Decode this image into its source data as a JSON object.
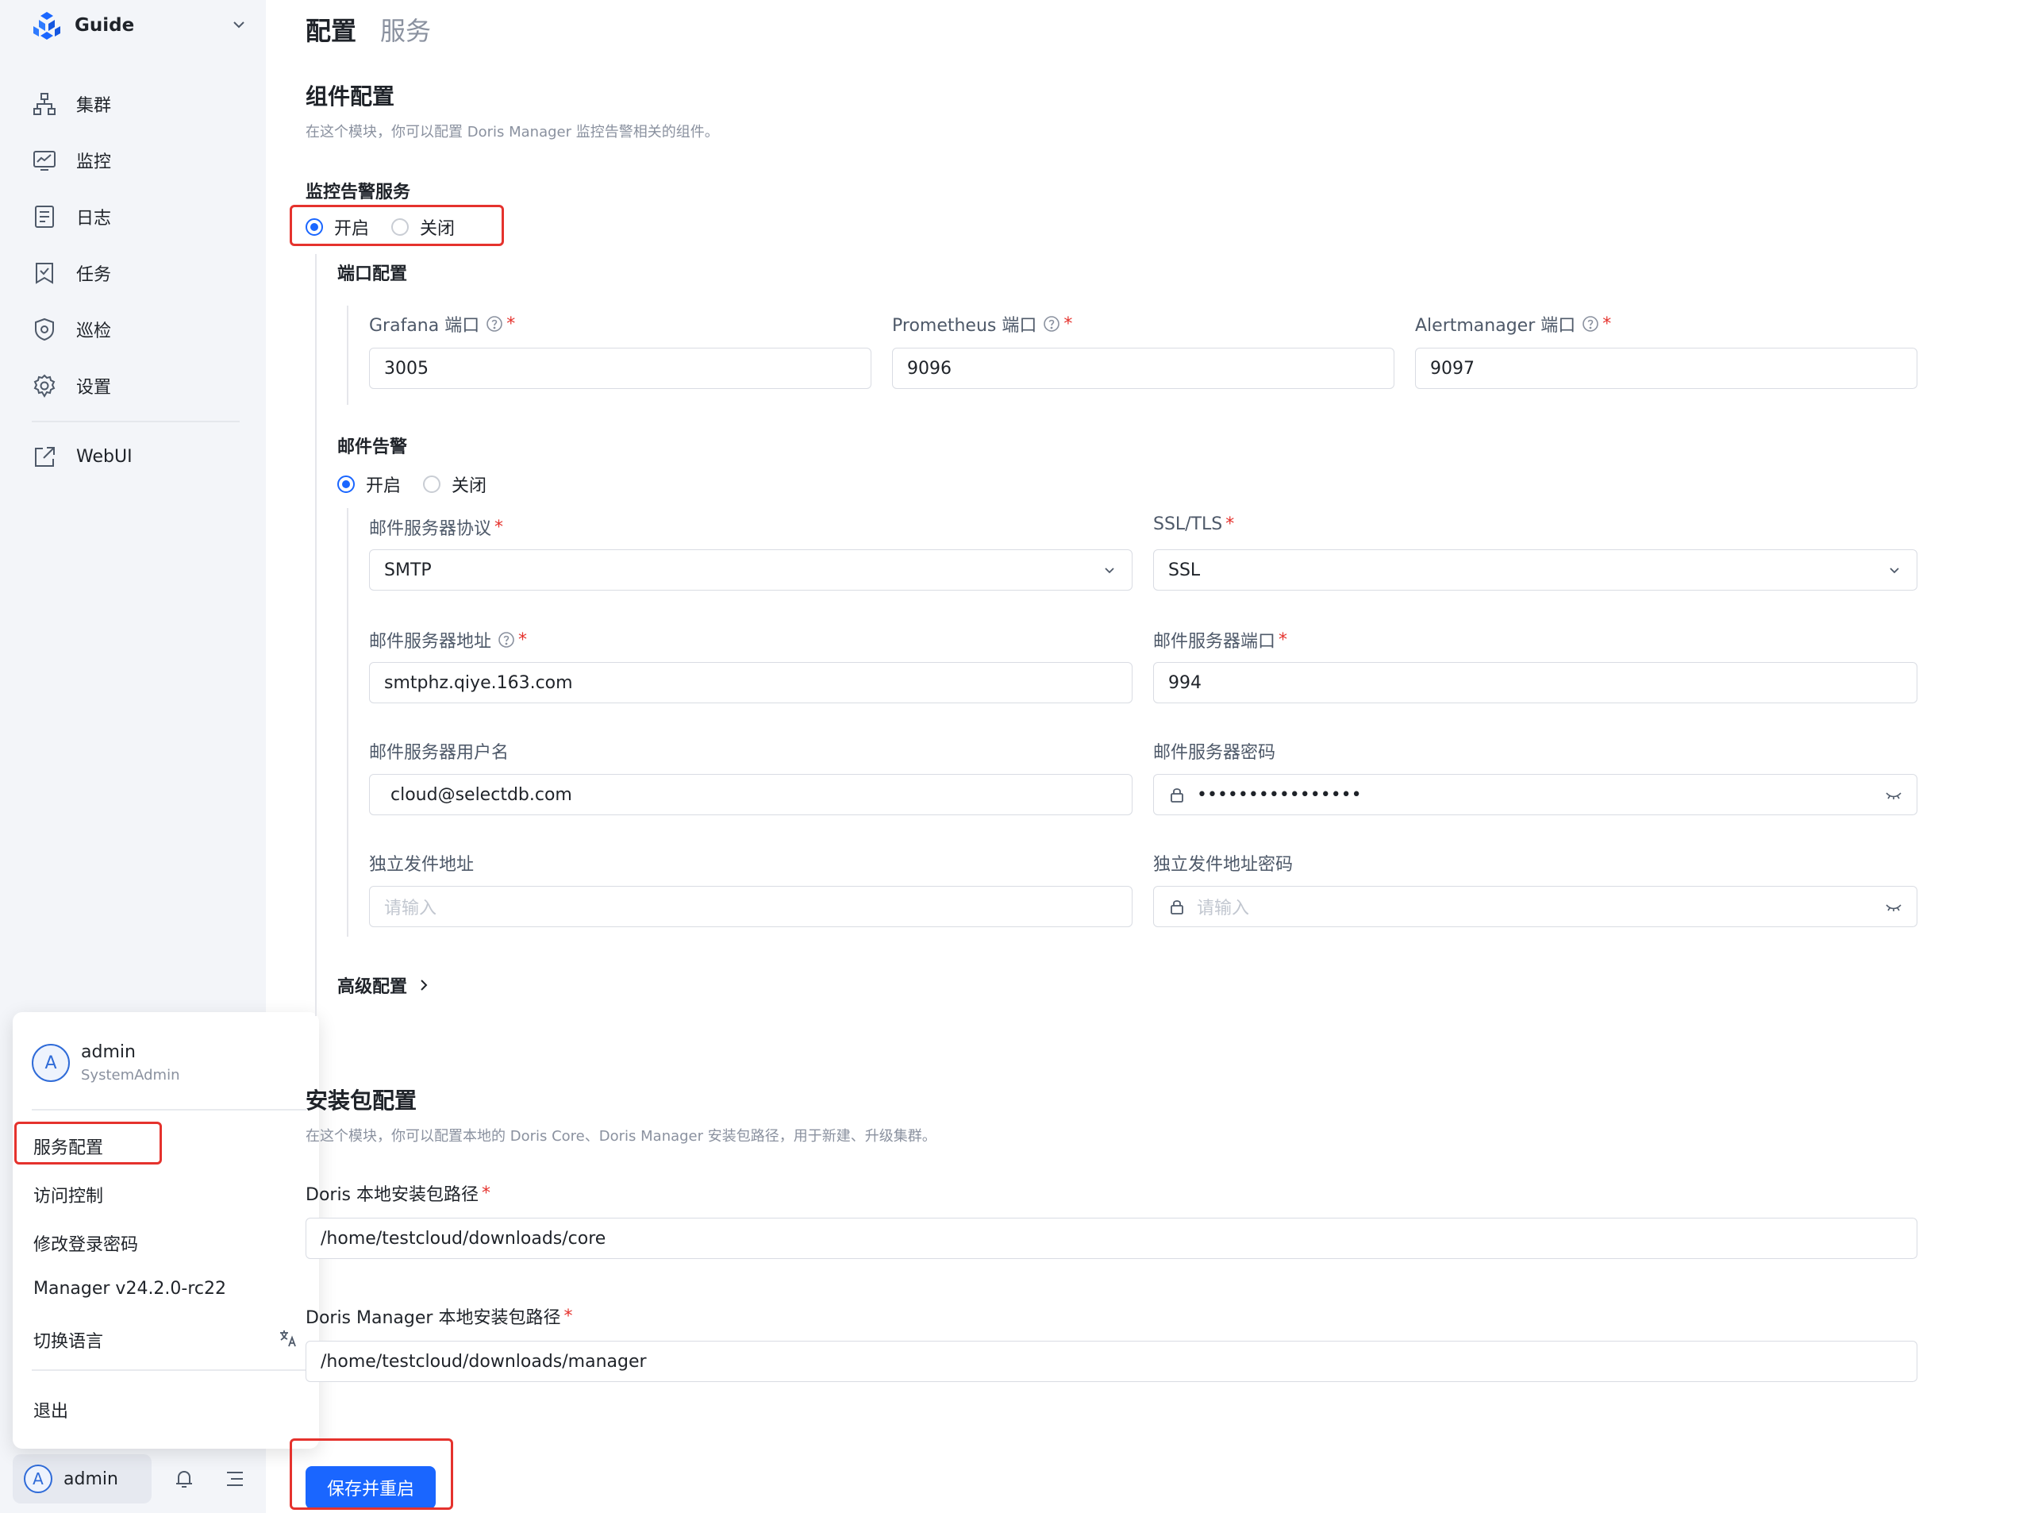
{
  "sidebar": {
    "brand": "Guide",
    "nav": [
      {
        "label": "集群",
        "icon": "cluster-icon"
      },
      {
        "label": "监控",
        "icon": "monitor-icon"
      },
      {
        "label": "日志",
        "icon": "log-icon"
      },
      {
        "label": "任务",
        "icon": "task-icon"
      },
      {
        "label": "巡检",
        "icon": "inspect-icon"
      },
      {
        "label": "设置",
        "icon": "gear-icon"
      }
    ],
    "webui": "WebUI",
    "user_chip": "admin",
    "avatar_letter": "A"
  },
  "popup": {
    "name": "admin",
    "role": "SystemAdmin",
    "items": [
      "服务配置",
      "访问控制",
      "修改登录密码",
      "Manager v24.2.0-rc22",
      "切换语言",
      "退出"
    ]
  },
  "tabs": [
    "配置",
    "服务"
  ],
  "component": {
    "title": "组件配置",
    "desc": "在这个模块，你可以配置 Doris Manager 监控告警相关的组件。",
    "monitor_label": "监控告警服务",
    "on": "开启",
    "off": "关闭",
    "port_title": "端口配置",
    "grafana_label": "Grafana 端口",
    "grafana_value": "3005",
    "prometheus_label": "Prometheus 端口",
    "prometheus_value": "9096",
    "alertmanager_label": "Alertmanager 端口",
    "alertmanager_value": "9097",
    "mail_title": "邮件告警",
    "protocol_label": "邮件服务器协议",
    "protocol_value": "SMTP",
    "ssl_label": "SSL/TLS",
    "ssl_value": "SSL",
    "server_label": "邮件服务器地址",
    "server_value": "smtphz.qiye.163.com",
    "port_label": "邮件服务器端口",
    "port_value": "994",
    "user_label": "邮件服务器用户名",
    "user_value": "cloud@selectdb.com",
    "pwd_label": "邮件服务器密码",
    "pwd_value": "••••••••••••••••",
    "sender_label": "独立发件地址",
    "sender_placeholder": "请输入",
    "sender_pwd_label": "独立发件地址密码",
    "sender_pwd_placeholder": "请输入",
    "advanced": "高级配置"
  },
  "package": {
    "title": "安装包配置",
    "desc": "在这个模块，你可以配置本地的 Doris Core、Doris Manager 安装包路径，用于新建、升级集群。",
    "core_label": "Doris 本地安装包路径",
    "core_value": "/home/testcloud/downloads/core",
    "manager_label": "Doris Manager 本地安装包路径",
    "manager_value": "/home/testcloud/downloads/manager"
  },
  "save_button": "保存并重启",
  "colors": {
    "accent": "#1a66ff",
    "highlight": "#e5322d",
    "sidebar_bg": "#f3f5f9"
  }
}
